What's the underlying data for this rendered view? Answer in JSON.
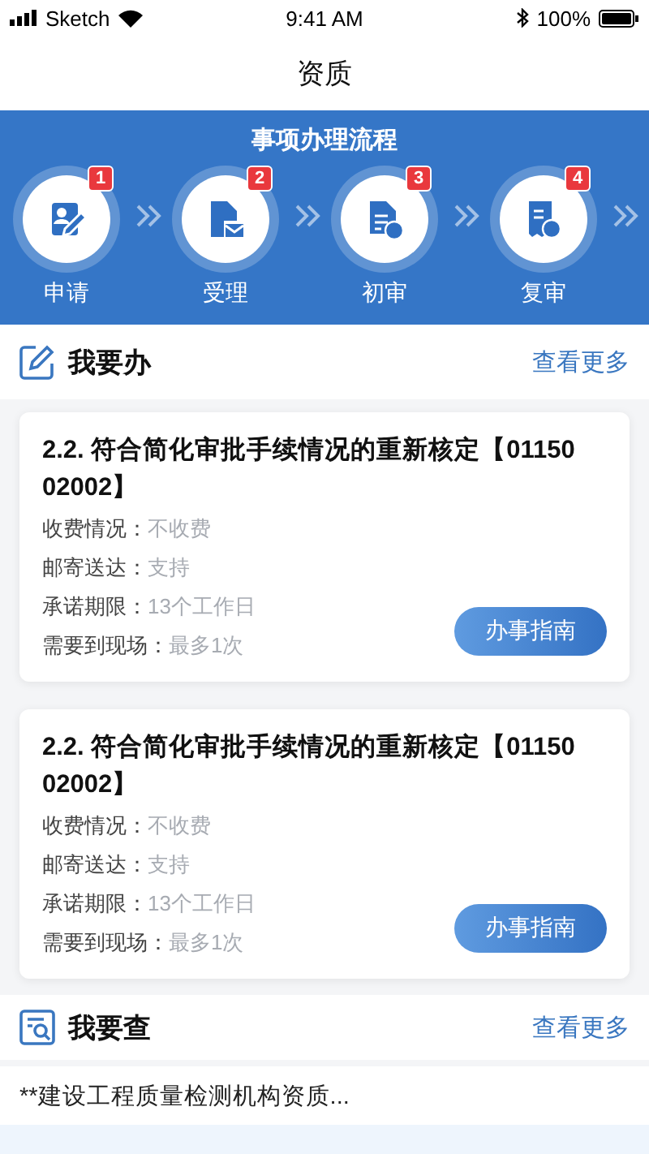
{
  "status_bar": {
    "carrier": "Sketch",
    "time": "9:41 AM",
    "battery": "100%"
  },
  "nav": {
    "title": "资质"
  },
  "process": {
    "title": "事项办理流程",
    "steps": [
      {
        "badge": "1",
        "label": "申请",
        "kind": "apply"
      },
      {
        "badge": "2",
        "label": "受理",
        "kind": "accept"
      },
      {
        "badge": "3",
        "label": "初审",
        "kind": "first"
      },
      {
        "badge": "4",
        "label": "复审",
        "kind": "review"
      }
    ]
  },
  "todo": {
    "title": "我要办",
    "more": "查看更多",
    "cards": [
      {
        "title": "2.2. 符合简化审批手续情况的重新核定【0115002002】",
        "fields": [
          {
            "label": "收费情况：",
            "value": "不收费"
          },
          {
            "label": "邮寄送达：",
            "value": "支持"
          },
          {
            "label": "承诺期限：",
            "value": "13个工作日"
          },
          {
            "label": "需要到现场：",
            "value": "最多1次"
          }
        ],
        "button": "办事指南"
      },
      {
        "title": "2.2. 符合简化审批手续情况的重新核定【0115002002】",
        "fields": [
          {
            "label": "收费情况：",
            "value": "不收费"
          },
          {
            "label": "邮寄送达：",
            "value": "支持"
          },
          {
            "label": "承诺期限：",
            "value": "13个工作日"
          },
          {
            "label": "需要到现场：",
            "value": "最多1次"
          }
        ],
        "button": "办事指南"
      }
    ]
  },
  "query": {
    "title": "我要查",
    "more": "查看更多",
    "items": [
      "**建设工程质量检测机构资质..."
    ]
  }
}
